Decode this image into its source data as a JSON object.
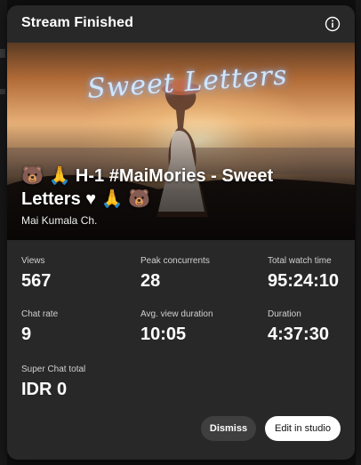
{
  "dialog": {
    "title": "Stream Finished",
    "info_icon": "info-icon"
  },
  "thumbnail": {
    "artwork_text": "Sweet Letters",
    "video_title": "🐻 🙏 H-1 #MaiMories - Sweet Letters ♥ 🙏 🐻",
    "channel_name": "Mai Kumala Ch."
  },
  "stats": [
    {
      "label": "Views",
      "value": "567"
    },
    {
      "label": "Peak concurrents",
      "value": "28"
    },
    {
      "label": "Total watch time",
      "value": "95:24:10"
    },
    {
      "label": "Chat rate",
      "value": "9"
    },
    {
      "label": "Avg. view duration",
      "value": "10:05"
    },
    {
      "label": "Duration",
      "value": "4:37:30"
    },
    {
      "label": "Super Chat total",
      "value": "IDR 0"
    }
  ],
  "actions": {
    "dismiss_label": "Dismiss",
    "edit_label": "Edit in studio"
  },
  "colors": {
    "dialog_bg": "#282828",
    "page_bg": "#0f0f0f",
    "dismiss_bg": "#3f3f3f",
    "primary_btn_bg": "#ffffff"
  }
}
